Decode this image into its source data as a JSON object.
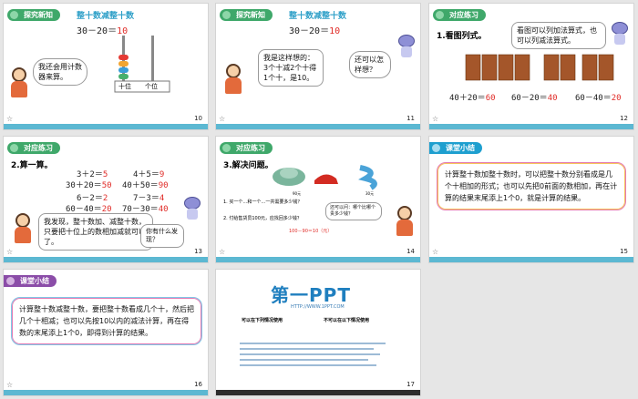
{
  "slides": {
    "s10": {
      "tag": "探究新知",
      "title": "整十数减整十数",
      "eq_left": "30－20＝",
      "eq_ans": "10",
      "bubble": "我还会用计数器来算。",
      "abacus_labels": [
        "十位",
        "个位"
      ],
      "page": "10"
    },
    "s11": {
      "tag": "探究新知",
      "title": "整十数减整十数",
      "eq_left": "30－20＝",
      "eq_ans": "10",
      "bubble1": "我是这样想的：3个十减2个十得1个十，是10。",
      "bubble2": "还可以怎样想？",
      "page": "11"
    },
    "s12": {
      "tag": "对应练习",
      "task": "1.看图列式。",
      "bubble": "看图可以列加法算式，也可以列减法算式。",
      "eqs": [
        {
          "left": "40＋20＝",
          "ans": "60"
        },
        {
          "left": "60－20＝",
          "ans": "40"
        },
        {
          "left": "60－40＝",
          "ans": "20"
        }
      ],
      "bundle_label": "10本",
      "page": "12"
    },
    "s13": {
      "tag": "对应练习",
      "task": "2.算一算。",
      "col1": [
        {
          "left": "3＋2＝",
          "ans": "5"
        },
        {
          "left": "30＋20＝",
          "ans": "50"
        },
        {
          "left": "6－2＝",
          "ans": "2"
        },
        {
          "left": "60－40＝",
          "ans": "20"
        }
      ],
      "col2": [
        {
          "left": "4＋5＝",
          "ans": "9"
        },
        {
          "left": "40＋50＝",
          "ans": "90"
        },
        {
          "left": "7－3＝",
          "ans": "4"
        },
        {
          "left": "70－30＝",
          "ans": "40"
        }
      ],
      "bubble1": "我发现，整十数加、减整十数，只要把十位上的数相加减就可以了。",
      "bubble2": "你有什么发现？",
      "page": "13"
    },
    "s14": {
      "tag": "对应练习",
      "task": "3.解决问题。",
      "prices": [
        "90元",
        "30元"
      ],
      "q1": "1. 买一个…和一个…一共需要多少钱？",
      "q2": "2. 付给售货员100元，应找回多少钱？",
      "ans": "100－90＝10（元）",
      "bubble": "还可以问：哪个比哪个贵多少钱？",
      "page": "14"
    },
    "s15": {
      "tag": "课堂小结",
      "text": "计算整十数加整十数时，可以把整十数分别看成是几个十相加的形式；也可以先把0前面的数相加，再在计算的结果末尾添上1个0，就是计算的结果。",
      "page": "15"
    },
    "s16": {
      "tag": "课堂小结",
      "text": "计算整十数减整十数，要把整十数看成几个十，然后把几个十相减；也可以先按10以内的减法计算，再在得数的末尾添上1个0，即得到计算的结果。",
      "page": "16"
    },
    "s17": {
      "logo": "第一PPT",
      "url": "HTTP://WWW.1PPT.COM",
      "col1_title": "可以在下列情况使用",
      "col2_title": "不可以在以下情况使用",
      "page": "17"
    }
  },
  "colors": {
    "green_tag": "#3fa86a",
    "blue_tag": "#1e9fcf",
    "answer_red": "#e02b27",
    "bottom_bar": "#5cb8d2"
  }
}
